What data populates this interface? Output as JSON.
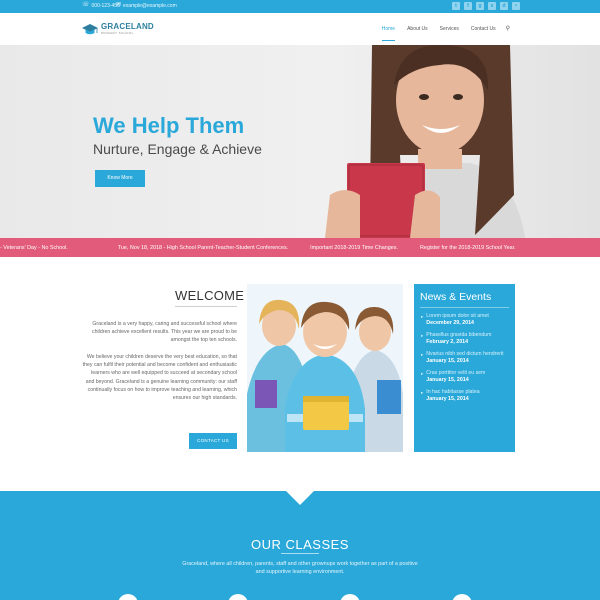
{
  "topbar": {
    "phone": "000-123-456",
    "email": "example@example.com",
    "socials": [
      "twitter-icon",
      "facebook-icon",
      "google-plus-icon",
      "skype-icon",
      "dribbble-icon",
      "flickr-icon"
    ]
  },
  "brand": {
    "name": "GRACELAND",
    "tagline": "PRIMARY SCHOOL",
    "accent": "#2aa8d9",
    "ticker_color": "#e25b7a"
  },
  "nav": {
    "items": [
      {
        "label": "Home",
        "active": true
      },
      {
        "label": "About Us",
        "active": false
      },
      {
        "label": "Services",
        "active": false
      },
      {
        "label": "Contact Us",
        "active": false
      }
    ]
  },
  "hero": {
    "title": "We Help Them",
    "subtitle": "Nurture, Engage & Achieve",
    "button": "Know More"
  },
  "ticker": {
    "items": [
      "- Veterans' Day - No School.",
      "Tue, Nov 18, 2018 - High School Parent-Teacher-Student Conferences.",
      "Important 2018-2019 Time Changes.",
      "Register for the 2018-2019 School Year."
    ]
  },
  "welcome": {
    "title": "WELCOME",
    "p1": "Graceland is a very happy, caring and successful school where children achieve excellent results. This year we are proud to be amongst the top ten schools.",
    "p2": "We believe your children deserve the very best education, so that they can fulfil their potential and become confident and enthusiastic learners who are well equipped to succeed at secondary school and beyond. Graceland is a genuine learning community: our staff continually focus on how to improve teaching and learning, which ensures our high standards.",
    "button": "CONTACT US"
  },
  "news": {
    "title": "News & Events",
    "items": [
      {
        "headline": "Lorem ipsum dolor sit amet",
        "date": "December 29, 2014"
      },
      {
        "headline": "Phasellus gravida bibendum",
        "date": "February 2, 2014"
      },
      {
        "headline": "Nvarius nibh sed dictum hendrerit",
        "date": "January 15, 2014"
      },
      {
        "headline": "Cras porttitor velit eu sem",
        "date": "January 15, 2014"
      },
      {
        "headline": "In hac habitasse platea",
        "date": "January 15, 2014"
      }
    ]
  },
  "classes": {
    "title": "OUR CLASSES",
    "text": "Graceland, where all children, parents, staff and other grownups work together as part of a positive and supportive learning environment."
  }
}
